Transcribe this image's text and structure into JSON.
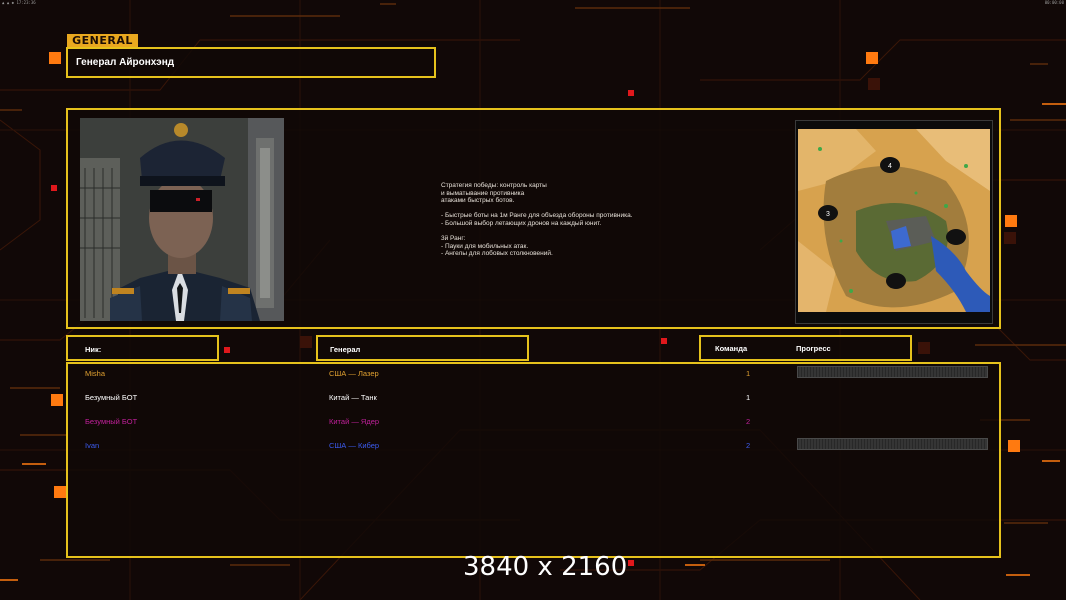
{
  "corner": {
    "left": "▲ ▲ ◆ 17:23:36",
    "right": "00:00:00"
  },
  "logo": "GENERAL",
  "general": {
    "title": "Генерал Айронхэнд"
  },
  "description": {
    "lines": [
      "Стратегия победы: контроль карты",
      "и выматывание противника",
      "атаками быстрых ботов.",
      "",
      "- Быстрые боты на 1м Ранге для объезда обороны противника.",
      "- Большой выбор летающих дронов на каждый юнит.",
      "",
      "3й Ранг:",
      "- Пауки для мобильных атак.",
      "- Ангелы для лобовых столкновений."
    ]
  },
  "minimap": {
    "bases": [
      "4",
      "3",
      "",
      ""
    ]
  },
  "headers": {
    "nick": "Ник:",
    "general": "Генерал",
    "team": "Команда",
    "progress": "Прогресс"
  },
  "players": [
    {
      "nick": "Misha",
      "general": "США — Лазер",
      "team": "1",
      "color": "#e0a030",
      "has_progress": true
    },
    {
      "nick": "Безумный БОТ",
      "general": "Китай — Танк",
      "team": "1",
      "color": "#ffffff",
      "has_progress": false
    },
    {
      "nick": "Безумный БОТ",
      "general": "Китай — Ядер",
      "team": "2",
      "color": "#c0209a",
      "has_progress": false
    },
    {
      "nick": "Ivan",
      "general": "США — Кибер",
      "team": "2",
      "color": "#3c5cf0",
      "has_progress": true
    }
  ],
  "resolution_label": "3840 x 2160",
  "colors": {
    "frame": "#e6c21c",
    "accent_orange": "#ff8a10",
    "background": "#110807"
  }
}
